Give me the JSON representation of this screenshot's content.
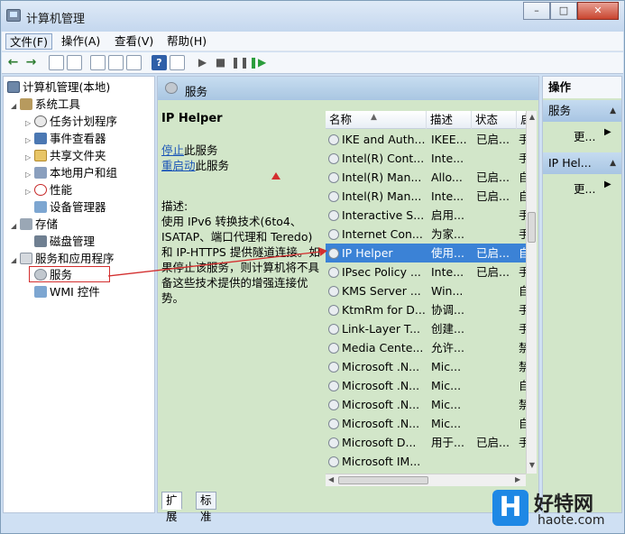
{
  "window": {
    "title": "计算机管理",
    "controls": [
      "minimize",
      "maximize",
      "close"
    ]
  },
  "menu": {
    "items": [
      "文件(F)",
      "操作(A)",
      "查看(V)",
      "帮助(H)"
    ]
  },
  "toolbar": {
    "icons": [
      "back-arrow-icon",
      "forward-arrow-icon",
      "up-folder-icon",
      "show-tree-icon",
      "properties-icon",
      "export-icon",
      "refresh-icon",
      "help-icon",
      "console-icon",
      "play-icon",
      "stop-icon",
      "pause-icon",
      "restart-icon"
    ]
  },
  "tree": {
    "root": "计算机管理(本地)",
    "system_tools": "系统工具",
    "task_scheduler": "任务计划程序",
    "event_viewer": "事件查看器",
    "shared_folders": "共享文件夹",
    "local_users": "本地用户和组",
    "performance": "性能",
    "device_manager": "设备管理器",
    "storage": "存储",
    "disk_management": "磁盘管理",
    "services_apps": "服务和应用程序",
    "services": "服务",
    "wmi": "WMI 控件"
  },
  "center": {
    "header_title": "服务",
    "selected_service_title": "IP Helper",
    "stop_link": "停止",
    "stop_suffix": "此服务",
    "restart_link": "重启动",
    "restart_suffix": "此服务",
    "desc_label": "描述:",
    "desc_text": "使用 IPv6 转换技术(6to4、ISATAP、端口代理和 Teredo)和 IP-HTTPS 提供隧道连接。如果停止该服务，则计算机将不具备这些技术提供的增强连接优势。",
    "columns": {
      "name": "名称",
      "desc": "描述",
      "status": "状态",
      "more": "启"
    },
    "rows": [
      {
        "name": "IKE and Auth...",
        "desc": "IKEE...",
        "status": "已启...",
        "more": "手"
      },
      {
        "name": "Intel(R) Cont...",
        "desc": "Inte...",
        "status": "",
        "more": "手"
      },
      {
        "name": "Intel(R) Man...",
        "desc": "Allo...",
        "status": "已启...",
        "more": "自"
      },
      {
        "name": "Intel(R) Man...",
        "desc": "Inte...",
        "status": "已启...",
        "more": "自"
      },
      {
        "name": "Interactive S...",
        "desc": "启用...",
        "status": "",
        "more": "手"
      },
      {
        "name": "Internet Con...",
        "desc": "为家...",
        "status": "",
        "more": "手"
      },
      {
        "name": "IP Helper",
        "desc": "使用...",
        "status": "已启...",
        "more": "自"
      },
      {
        "name": "IPsec Policy ...",
        "desc": "Inte...",
        "status": "已启...",
        "more": "手"
      },
      {
        "name": "KMS Server ...",
        "desc": "Win...",
        "status": "",
        "more": "自"
      },
      {
        "name": "KtmRm for D...",
        "desc": "协调...",
        "status": "",
        "more": "手"
      },
      {
        "name": "Link-Layer T...",
        "desc": "创建...",
        "status": "",
        "more": "手"
      },
      {
        "name": "Media Cente...",
        "desc": "允许...",
        "status": "",
        "more": "禁"
      },
      {
        "name": "Microsoft .N...",
        "desc": "Mic...",
        "status": "",
        "more": "禁"
      },
      {
        "name": "Microsoft .N...",
        "desc": "Mic...",
        "status": "",
        "more": "自"
      },
      {
        "name": "Microsoft .N...",
        "desc": "Mic...",
        "status": "",
        "more": "禁"
      },
      {
        "name": "Microsoft .N...",
        "desc": "Mic...",
        "status": "",
        "more": "自"
      },
      {
        "name": "Microsoft D...",
        "desc": "用于...",
        "status": "已启...",
        "more": "手"
      },
      {
        "name": "Microsoft IM...",
        "desc": "",
        "status": "",
        "more": ""
      }
    ],
    "selected_row_index": 6,
    "tabs": [
      "扩展",
      "标准"
    ]
  },
  "actions": {
    "header": "操作",
    "section1": "服务",
    "section1_more": "更...",
    "section2": "IP Hel...",
    "section2_more": "更..."
  },
  "watermark": {
    "logo_letter": "H",
    "cn": "好特网",
    "url": "haote.com"
  },
  "colors": {
    "pane_green": "#d2e6c9",
    "selection_blue": "#3b82d6",
    "link_blue": "#1a55b8",
    "annotation_red": "#d32f2f"
  }
}
